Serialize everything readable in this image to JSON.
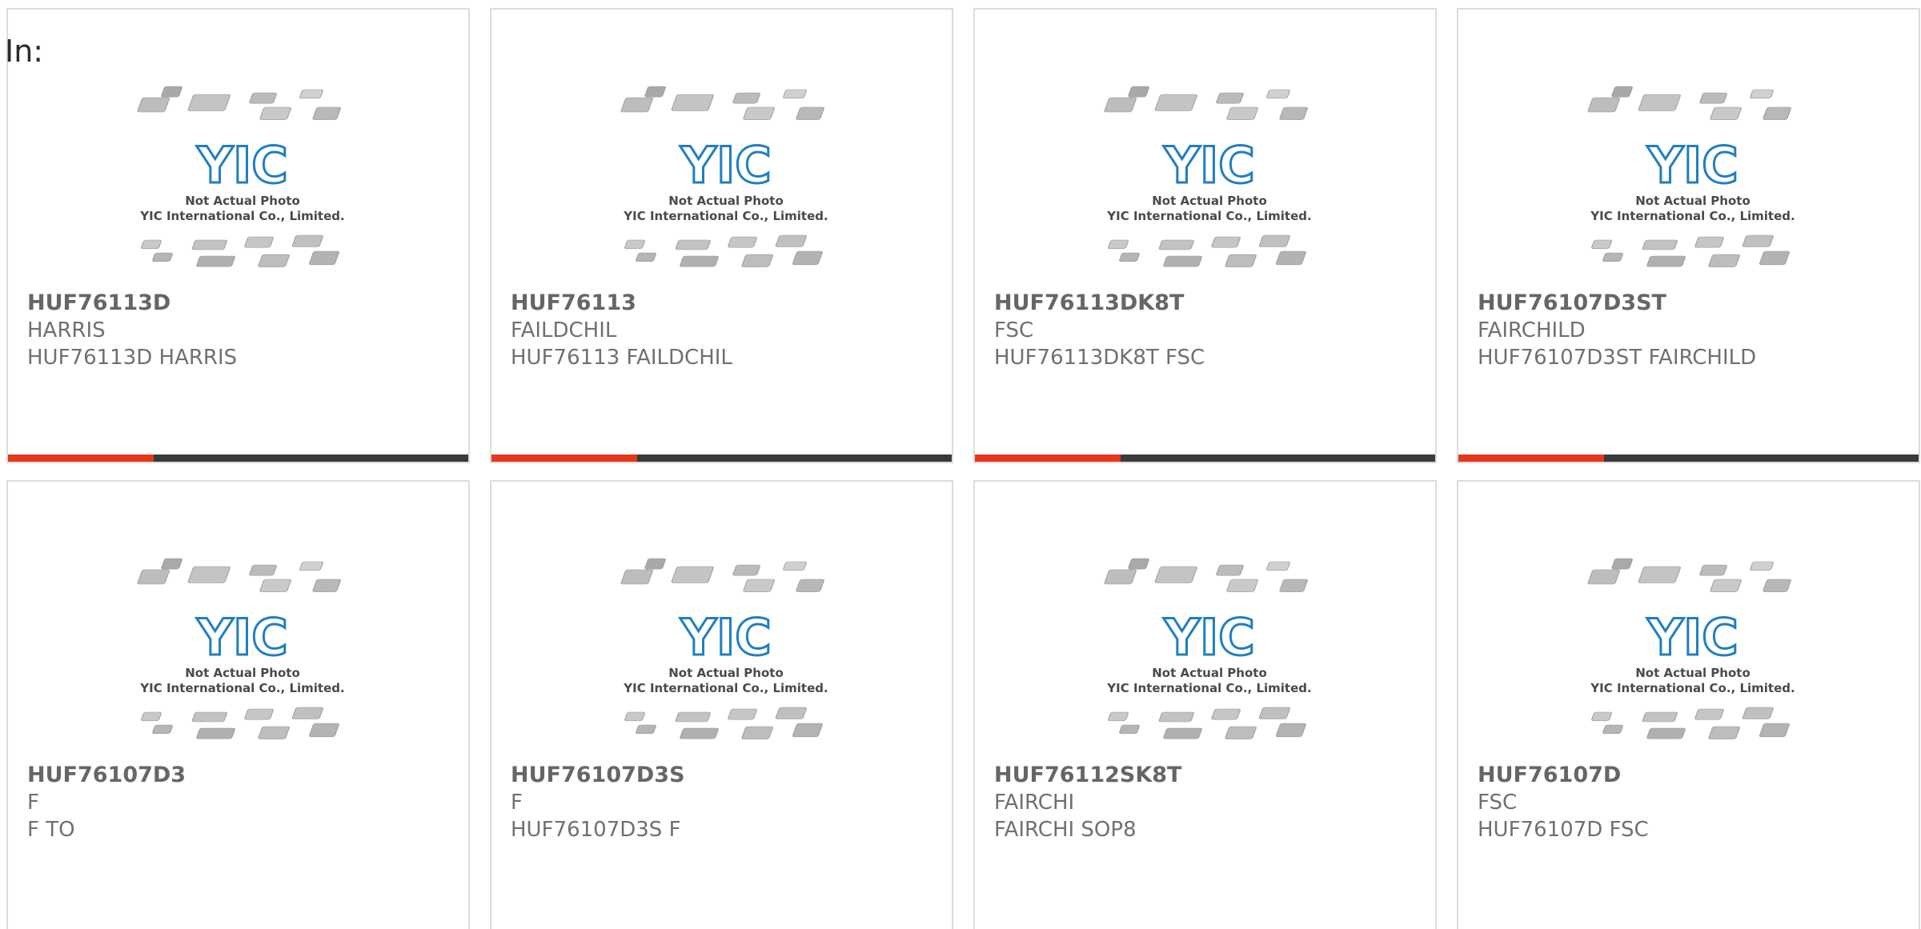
{
  "header": {
    "label": "In:"
  },
  "placeholder_image": {
    "logo": "YIC",
    "caption_line1": "Not Actual Photo",
    "caption_line2": "YIC International Co., Limited.",
    "logo_color": "#1f7fc0"
  },
  "colors": {
    "accent_bar": "#e5391c",
    "bar_base": "#3a3a3a",
    "card_border": "#dcdcdc"
  },
  "products": [
    {
      "part": "HUF76113D",
      "manufacturer": "HARRIS",
      "description": "HUF76113D HARRIS"
    },
    {
      "part": "HUF76113",
      "manufacturer": "FAILDCHIL",
      "description": "HUF76113 FAILDCHIL"
    },
    {
      "part": "HUF76113DK8T",
      "manufacturer": "FSC",
      "description": "HUF76113DK8T FSC"
    },
    {
      "part": "HUF76107D3ST",
      "manufacturer": "FAIRCHILD",
      "description": "HUF76107D3ST FAIRCHILD"
    },
    {
      "part": "HUF76107D3",
      "manufacturer": "F",
      "description": "F TO"
    },
    {
      "part": "HUF76107D3S",
      "manufacturer": "F",
      "description": "HUF76107D3S F"
    },
    {
      "part": "HUF76112SK8T",
      "manufacturer": "FAIRCHI",
      "description": "FAIRCHI SOP8"
    },
    {
      "part": "HUF76107D",
      "manufacturer": "FSC",
      "description": "HUF76107D FSC"
    }
  ]
}
